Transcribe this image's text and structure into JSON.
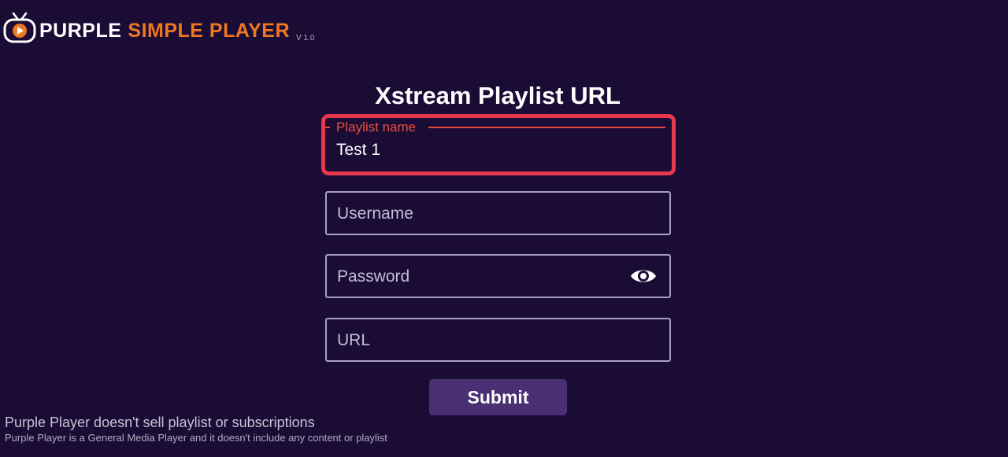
{
  "app": {
    "brand_part_1": "PURPLE",
    "brand_part_2": "SIMPLE PLAYER",
    "version": "V 1.0",
    "icon": "tv-play-icon"
  },
  "form": {
    "title": "Xstream Playlist URL",
    "playlist_name": {
      "label": "Playlist name",
      "value": "Test 1"
    },
    "username": {
      "placeholder": "Username",
      "value": ""
    },
    "password": {
      "placeholder": "Password",
      "value": "",
      "toggle_icon": "eye-icon"
    },
    "url": {
      "placeholder": "URL",
      "value": ""
    },
    "submit_label": "Submit"
  },
  "footer": {
    "line_1": "Purple Player doesn't sell playlist or subscriptions",
    "line_2": "Purple Player is a General Media Player and it doesn't include any content or playlist"
  },
  "colors": {
    "background": "#1b0c35",
    "accent_orange": "#ee7722",
    "focus_border": "#e8364b",
    "button": "#4a2f72"
  }
}
